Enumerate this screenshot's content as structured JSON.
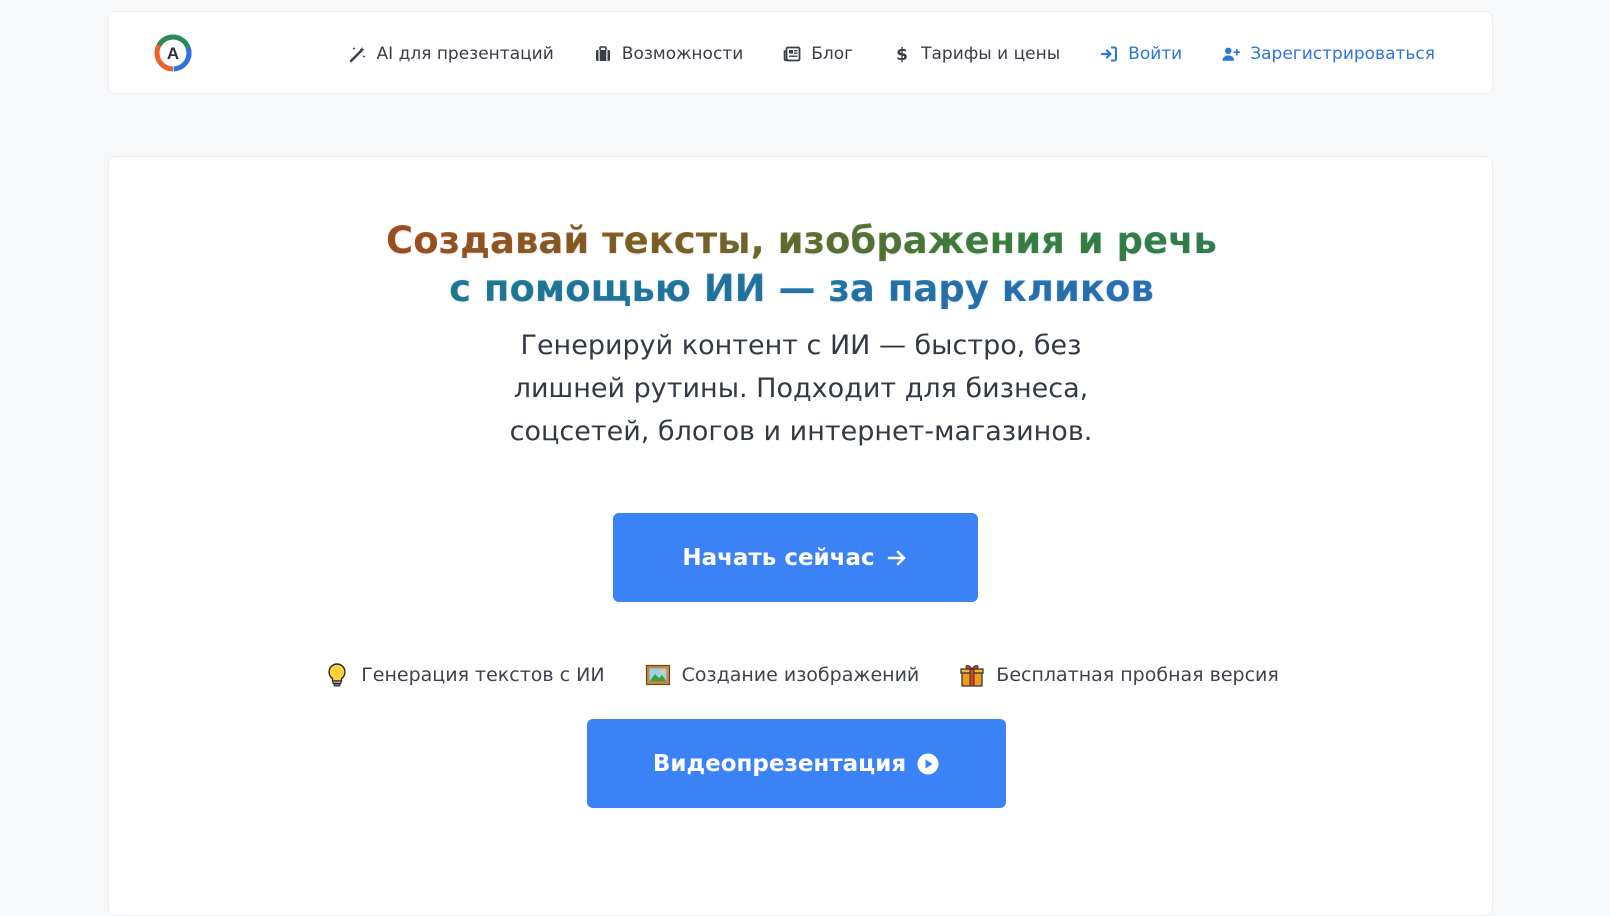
{
  "navbar": {
    "logo_letter": "A",
    "items": [
      {
        "label": "AI для презентаций",
        "icon": "magic-wand-icon"
      },
      {
        "label": "Возможности",
        "icon": "briefcase-icon"
      },
      {
        "label": "Блог",
        "icon": "newspaper-icon"
      },
      {
        "label": "Тарифы и цены",
        "icon": "dollar-icon"
      },
      {
        "label": "Войти",
        "icon": "sign-in-icon"
      },
      {
        "label": "Зарегистрироваться",
        "icon": "user-plus-icon"
      }
    ]
  },
  "hero": {
    "headline_line1": "Создавай тексты, изображения и речь",
    "headline_line2": "с помощью ИИ — за пару кликов",
    "subtitle": "Генерируй контент с ИИ — быстро, без лишней рутины. Подходит для бизнеса, соцсетей, блогов и интернет-магазинов.",
    "cta_label": "Начать сейчас",
    "cta_icon": "arrow-right-icon",
    "features": [
      {
        "label": "Генерация текстов с ИИ",
        "icon": "lightbulb-icon"
      },
      {
        "label": "Создание изображений",
        "icon": "framed-picture-icon"
      },
      {
        "label": "Бесплатная пробная версия",
        "icon": "gift-icon"
      }
    ],
    "video_label": "Видеопрезентация",
    "video_icon": "play-circle-icon"
  },
  "colors": {
    "accent": "#3b82f6",
    "link": "#2f74d9",
    "background": "#f7f8fa"
  }
}
